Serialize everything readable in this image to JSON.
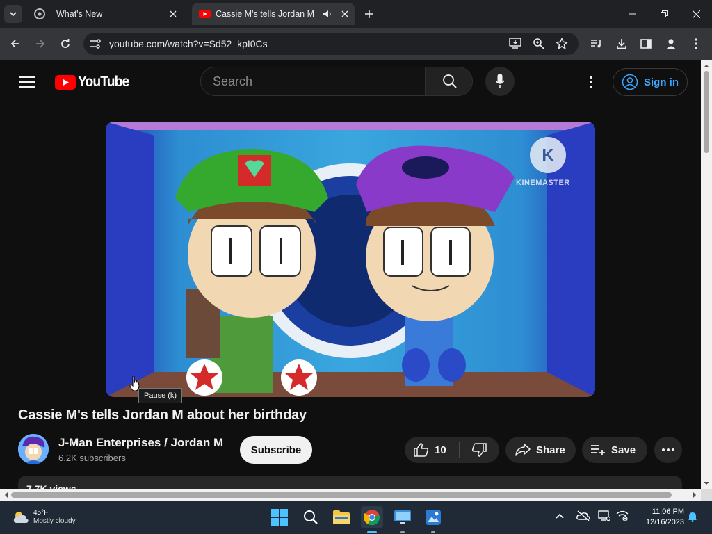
{
  "browser": {
    "tabs": [
      {
        "title": "What's New"
      },
      {
        "title": "Cassie M's tells Jordan M abo"
      }
    ],
    "url": "youtube.com/watch?v=Sd52_kpI0Cs"
  },
  "youtube": {
    "logo_text": "YouTube",
    "search_placeholder": "Search",
    "sign_in_label": "Sign in",
    "video": {
      "title": "Cassie M's tells Jordan M about her birthday",
      "watermark": "KINEMASTER",
      "tooltip": "Pause (k)"
    },
    "channel": {
      "name": "J-Man Enterprises / Jordan M",
      "subscribers": "6.2K subscribers"
    },
    "actions": {
      "subscribe": "Subscribe",
      "like_count": "10",
      "share": "Share",
      "save": "Save"
    },
    "description_preview": "7.7K views"
  },
  "taskbar": {
    "weather_temp": "45°F",
    "weather_desc": "Mostly cloudy",
    "time": "11:06 PM",
    "date": "12/16/2023"
  }
}
